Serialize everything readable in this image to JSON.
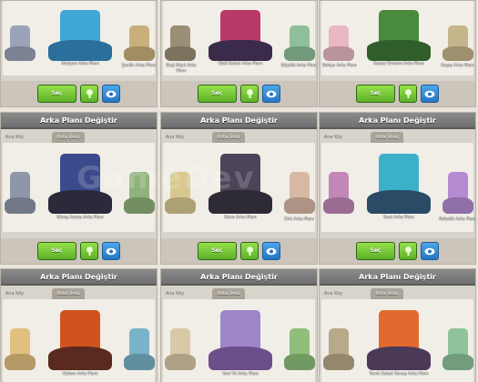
{
  "panels": [
    {
      "title": "",
      "tab_home": "",
      "tab_builder": "",
      "scene_main": "Aksiyon Arka Planı",
      "scene_left": "",
      "scene_right": "Şenlik Arka Planı",
      "colors": {
        "main": "#3fa7d6",
        "main_base": "#2b6f9c",
        "left": "#9aa3b8",
        "right": "#c9b07a"
      },
      "btn_select": "Seç"
    },
    {
      "title": "",
      "tab_home": "",
      "tab_builder": "",
      "scene_main": "Gizli Kalesi Arka Planı",
      "scene_left": "Dağ Köyü Arka Planı",
      "scene_right": "Büyülü Arka Planı",
      "colors": {
        "main": "#b83a68",
        "main_base": "#3a2b4a",
        "left": "#9b8e76",
        "right": "#8fbf9a"
      },
      "btn_select": "Seç"
    },
    {
      "title": "",
      "tab_home": "",
      "tab_builder": "",
      "scene_main": "Kuzey Ormanı Arka Planı",
      "scene_left": "Bahçe Arka Planı",
      "scene_right": "Kayıp Arka Planı",
      "colors": {
        "main": "#4a8a3c",
        "main_base": "#2f5e2a",
        "left": "#e9b8c2",
        "right": "#c6b48a"
      },
      "btn_select": "Seç"
    },
    {
      "title": "Arka Planı Değiştir",
      "tab_home": "Ana Köy",
      "tab_builder": "Usta Üssü",
      "scene_main": "Güreş Arena Arka Planı",
      "scene_left": "",
      "scene_right": "",
      "colors": {
        "main": "#3a4a8c",
        "main_base": "#2a2a3a",
        "left": "#8d97a8",
        "right": "#8fb27a"
      },
      "btn_select": "Seç"
    },
    {
      "title": "Arka Planı Değiştir",
      "tab_home": "Ana Köy",
      "tab_builder": "Usta Üssü",
      "scene_main": "Gece Arka Planı",
      "scene_left": "",
      "scene_right": "Sirk Arka Planı",
      "colors": {
        "main": "#4c4458",
        "main_base": "#2e2a36",
        "left": "#d8c88e",
        "right": "#d7b8a4"
      },
      "btn_select": "Seç"
    },
    {
      "title": "Arka Planı Değiştir",
      "tab_home": "Ana Köy",
      "tab_builder": "Usta Üssü",
      "scene_main": "Saat Arka Planı",
      "scene_left": "",
      "scene_right": "Robotik Arka Planı",
      "colors": {
        "main": "#3db0c9",
        "main_base": "#2a4a66",
        "left": "#c287b8",
        "right": "#b48ad0"
      },
      "btn_select": "Seç"
    },
    {
      "title": "Arka Planı Değiştir",
      "tab_home": "Ana Köy",
      "tab_builder": "Usta Üssü",
      "scene_main": "Golem Arka Planı",
      "scene_left": "",
      "scene_right": "",
      "colors": {
        "main": "#d0531e",
        "main_base": "#5a2a1e",
        "left": "#e1c07f",
        "right": "#78b3c8"
      },
      "btn_select": ""
    },
    {
      "title": "Arka Planı Değiştir",
      "tab_home": "Ana Köy",
      "tab_builder": "Usta Üssü",
      "scene_main": "Yeni Yıl Arka Planı",
      "scene_left": "",
      "scene_right": "",
      "colors": {
        "main": "#9d86c9",
        "main_base": "#6a4f8a",
        "left": "#d9c9a7",
        "right": "#8fbf7a"
      },
      "btn_select": ""
    },
    {
      "title": "Arka Planı Değiştir",
      "tab_home": "Ana Köy",
      "tab_builder": "Usta Üssü",
      "scene_main": "Yanık Kalesi Savaş Arka Planı",
      "scene_left": "",
      "scene_right": "",
      "colors": {
        "main": "#e36a2e",
        "main_base": "#4a3a58",
        "left": "#b8a98a",
        "right": "#8fc39a"
      },
      "btn_select": ""
    }
  ],
  "watermark": "GameDev"
}
